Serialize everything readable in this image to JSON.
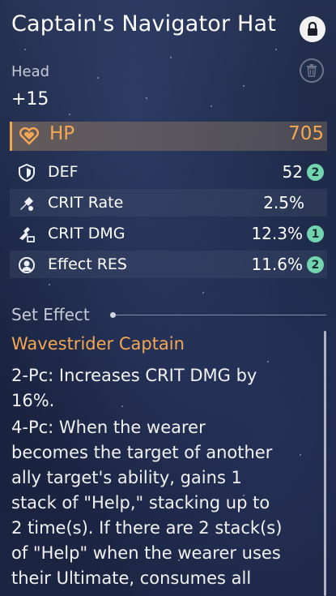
{
  "item": {
    "name": "Captain's Navigator Hat",
    "slot": "Head",
    "level": "+15"
  },
  "main_stat": {
    "name": "HP",
    "value": "705",
    "icon": "heart-icon"
  },
  "substats": [
    {
      "name": "DEF",
      "value": "52",
      "rolls": "2",
      "icon": "shield-icon"
    },
    {
      "name": "CRIT Rate",
      "value": "2.5%",
      "rolls": "",
      "icon": "crit-rate-icon"
    },
    {
      "name": "CRIT DMG",
      "value": "12.3%",
      "rolls": "1",
      "icon": "crit-dmg-icon"
    },
    {
      "name": "Effect RES",
      "value": "11.6%",
      "rolls": "2",
      "icon": "effect-res-icon"
    }
  ],
  "set_effect": {
    "header": "Set Effect",
    "name": "Wavestrider Captain",
    "two_pc_lines": [
      "2-Pc: Increases CRIT DMG by",
      "16%."
    ],
    "four_pc_lines": [
      "4-Pc: When the wearer",
      "becomes the target of another",
      "ally target's ability, gains 1",
      "stack of \"Help,\" stacking up to",
      "2 time(s). If there are 2 stack(s)",
      "of \"Help\" when the wearer uses",
      "their Ultimate, consumes all"
    ]
  },
  "colors": {
    "accent": "#f5a751",
    "badge": "#73d5b0"
  }
}
